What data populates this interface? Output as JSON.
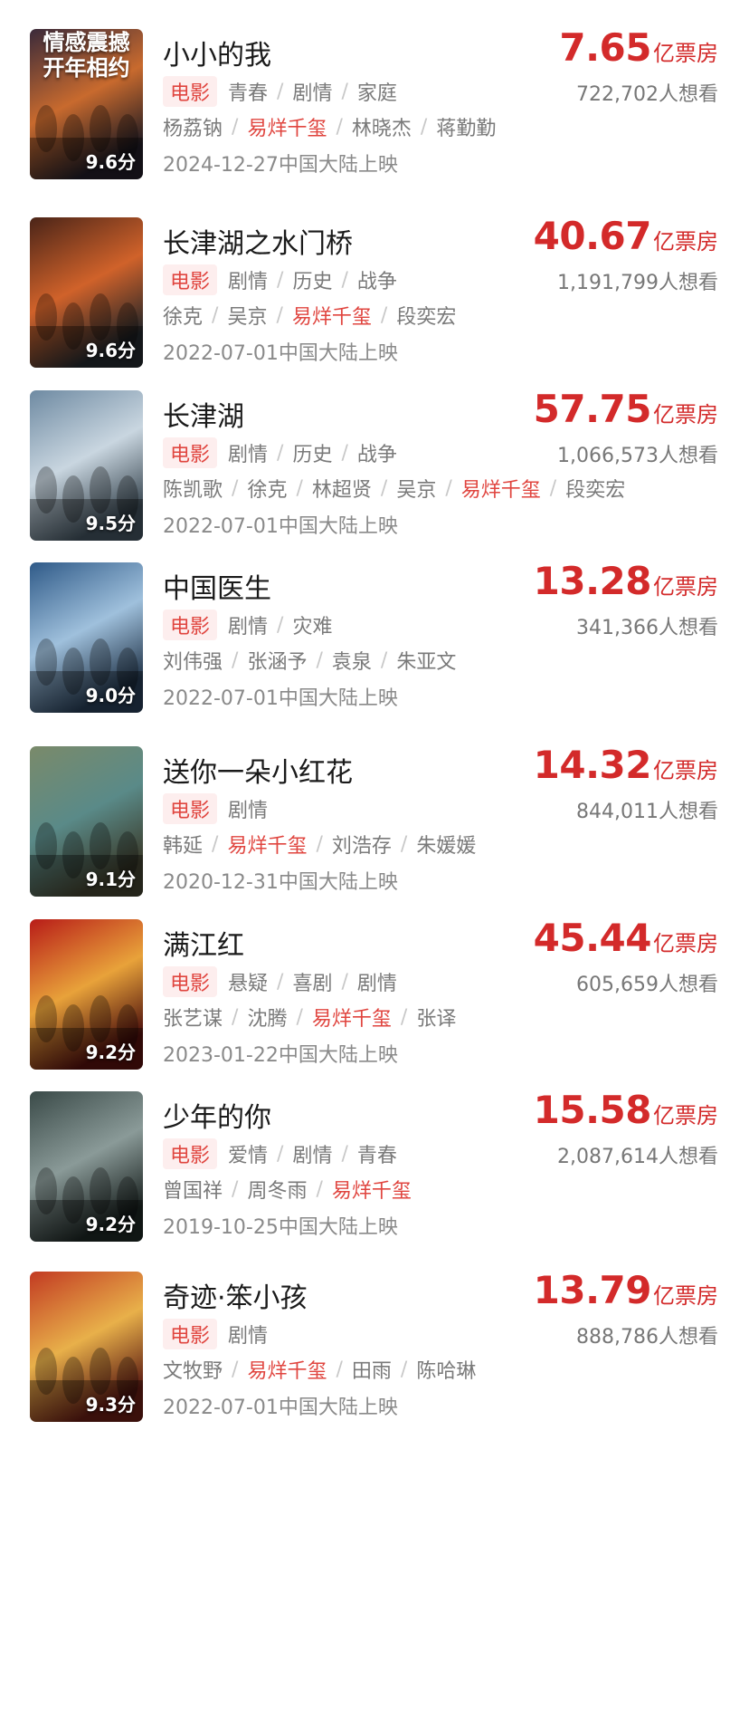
{
  "movies": [
    {
      "title": "小小的我",
      "box_value": "7.65",
      "box_unit": "亿票房",
      "want": "722,702人想看",
      "badge": "电影",
      "genres": [
        "青春",
        "剧情",
        "家庭"
      ],
      "cast": [
        "杨荔钠",
        "易烊千玺",
        "林晓杰",
        "蒋勤勤"
      ],
      "highlight": "易烊千玺",
      "release": "2024-12-27中国大陆上映",
      "score": "9.6分",
      "poster_text": "情感震撼\n开年相约",
      "colors": [
        "#3a2a3a",
        "#c86a2e",
        "#1e1a22"
      ]
    },
    {
      "title": "长津湖之水门桥",
      "box_value": "40.67",
      "box_unit": "亿票房",
      "want": "1,191,799人想看",
      "badge": "电影",
      "genres": [
        "剧情",
        "历史",
        "战争"
      ],
      "cast": [
        "徐克",
        "吴京",
        "易烊千玺",
        "段奕宏"
      ],
      "highlight": "易烊千玺",
      "release": "2022-07-01中国大陆上映",
      "score": "9.6分",
      "poster_text": "",
      "colors": [
        "#4a2418",
        "#d0622a",
        "#202428"
      ]
    },
    {
      "title": "长津湖",
      "box_value": "57.75",
      "box_unit": "亿票房",
      "want": "1,066,573人想看",
      "badge": "电影",
      "genres": [
        "剧情",
        "历史",
        "战争"
      ],
      "cast": [
        "陈凯歌",
        "徐克",
        "林超贤",
        "吴京",
        "易烊千玺",
        "段奕宏"
      ],
      "highlight": "易烊千玺",
      "release": "2022-07-01中国大陆上映",
      "score": "9.5分",
      "poster_text": "",
      "colors": [
        "#6e8aa2",
        "#c9d6e0",
        "#3a4852"
      ]
    },
    {
      "title": "中国医生",
      "box_value": "13.28",
      "box_unit": "亿票房",
      "want": "341,366人想看",
      "badge": "电影",
      "genres": [
        "剧情",
        "灾难"
      ],
      "cast": [
        "刘伟强",
        "张涵予",
        "袁泉",
        "朱亚文"
      ],
      "highlight": "",
      "release": "2022-07-01中国大陆上映",
      "score": "9.0分",
      "poster_text": "",
      "colors": [
        "#2f5a88",
        "#9fc0dc",
        "#22354a"
      ]
    },
    {
      "title": "送你一朵小红花",
      "box_value": "14.32",
      "box_unit": "亿票房",
      "want": "844,011人想看",
      "badge": "电影",
      "genres": [
        "剧情"
      ],
      "cast": [
        "韩延",
        "易烊千玺",
        "刘浩存",
        "朱媛媛"
      ],
      "highlight": "易烊千玺",
      "release": "2020-12-31中国大陆上映",
      "score": "9.1分",
      "poster_text": "",
      "colors": [
        "#7a8a6a",
        "#5a8a88",
        "#3a3a2a"
      ]
    },
    {
      "title": "满江红",
      "box_value": "45.44",
      "box_unit": "亿票房",
      "want": "605,659人想看",
      "badge": "电影",
      "genres": [
        "悬疑",
        "喜剧",
        "剧情"
      ],
      "cast": [
        "张艺谋",
        "沈腾",
        "易烊千玺",
        "张译"
      ],
      "highlight": "易烊千玺",
      "release": "2023-01-22中国大陆上映",
      "score": "9.2分",
      "poster_text": "",
      "colors": [
        "#b81c18",
        "#e8a23a",
        "#4a0e0c"
      ]
    },
    {
      "title": "少年的你",
      "box_value": "15.58",
      "box_unit": "亿票房",
      "want": "2,087,614人想看",
      "badge": "电影",
      "genres": [
        "爱情",
        "剧情",
        "青春"
      ],
      "cast": [
        "曾国祥",
        "周冬雨",
        "易烊千玺"
      ],
      "highlight": "易烊千玺",
      "release": "2019-10-25中国大陆上映",
      "score": "9.2分",
      "poster_text": "",
      "colors": [
        "#3a4a48",
        "#8a9a98",
        "#1a2220"
      ]
    },
    {
      "title": "奇迹·笨小孩",
      "box_value": "13.79",
      "box_unit": "亿票房",
      "want": "888,786人想看",
      "badge": "电影",
      "genres": [
        "剧情"
      ],
      "cast": [
        "文牧野",
        "易烊千玺",
        "田雨",
        "陈哈琳"
      ],
      "highlight": "易烊千玺",
      "release": "2022-07-01中国大陆上映",
      "score": "9.3分",
      "poster_text": "",
      "colors": [
        "#c23a22",
        "#e8b04a",
        "#5a1a12"
      ]
    }
  ]
}
